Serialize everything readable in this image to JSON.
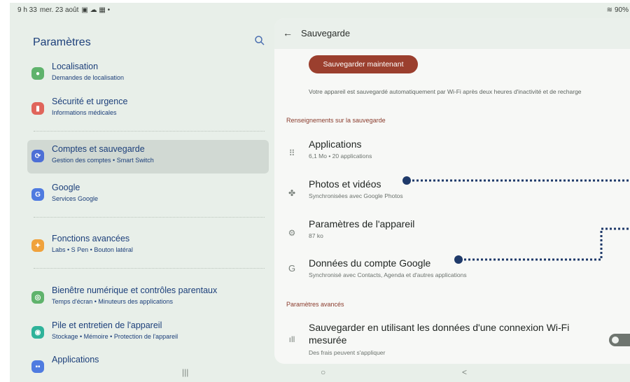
{
  "status_bar": {
    "time": "9 h 33",
    "date": "mer. 23 août",
    "battery": "90%"
  },
  "left": {
    "title": "Paramètres",
    "items": [
      {
        "title": "Localisation",
        "subtitle": "Demandes de localisation",
        "icon": "location-icon",
        "color": "#5fb36c"
      },
      {
        "title": "Sécurité et urgence",
        "subtitle": "Informations médicales",
        "icon": "emergency-icon",
        "color": "#e0655b"
      },
      {
        "title": "Comptes et sauvegarde",
        "subtitle": "Gestion des comptes • Smart Switch",
        "icon": "sync-icon",
        "color": "#4d6fd6"
      },
      {
        "title": "Google",
        "subtitle": "Services Google",
        "icon": "google-icon",
        "color": "#4f7be0"
      },
      {
        "title": "Fonctions avancées",
        "subtitle": "Labs • S Pen • Bouton latéral",
        "icon": "star-icon",
        "color": "#f0a23c"
      },
      {
        "title": "Bienêtre numérique et contrôles parentaux",
        "subtitle": "Temps d'écran • Minuteurs des applications",
        "icon": "wellbeing-icon",
        "color": "#5fb36c"
      },
      {
        "title": "Pile et entretien de l'appareil",
        "subtitle": "Stockage • Mémoire • Protection de l'appareil",
        "icon": "device-care-icon",
        "color": "#2fb39a"
      },
      {
        "title": "Applications",
        "subtitle": "",
        "icon": "apps-icon",
        "color": "#4f7be0"
      }
    ]
  },
  "right": {
    "header_title": "Sauvegarde",
    "backup_button": "Sauvegarder maintenant",
    "backup_note": "Votre appareil est sauvegardé automatiquement par Wi-Fi après deux heures d'inactivité et de recharge",
    "section1": "Renseignements sur la sauvegarde",
    "items": [
      {
        "title": "Applications",
        "subtitle": "6,1 Mo • 20 applications",
        "icon": "grid-icon"
      },
      {
        "title": "Photos et vidéos",
        "subtitle": "Synchronisées avec Google Photos",
        "icon": "pinwheel-icon"
      },
      {
        "title": "Paramètres de l'appareil",
        "subtitle": "87 ko",
        "icon": "gear-icon"
      },
      {
        "title": "Données du compte Google",
        "subtitle": "Synchronisé avec Contacts, Agenda et d'autres applications",
        "icon": "google-g-icon"
      }
    ],
    "section2": "Paramètres avancés",
    "advanced": {
      "title_line1": "Sauvegarder en utilisant les données d'une connexion Wi-Fi",
      "title_line2": "mesurée",
      "subtitle": "Des frais peuvent s'appliquer",
      "icon": "signal-bars-icon",
      "toggle_on": false
    }
  },
  "navbar": {
    "recent": "|||",
    "home": "○",
    "back": "<"
  }
}
